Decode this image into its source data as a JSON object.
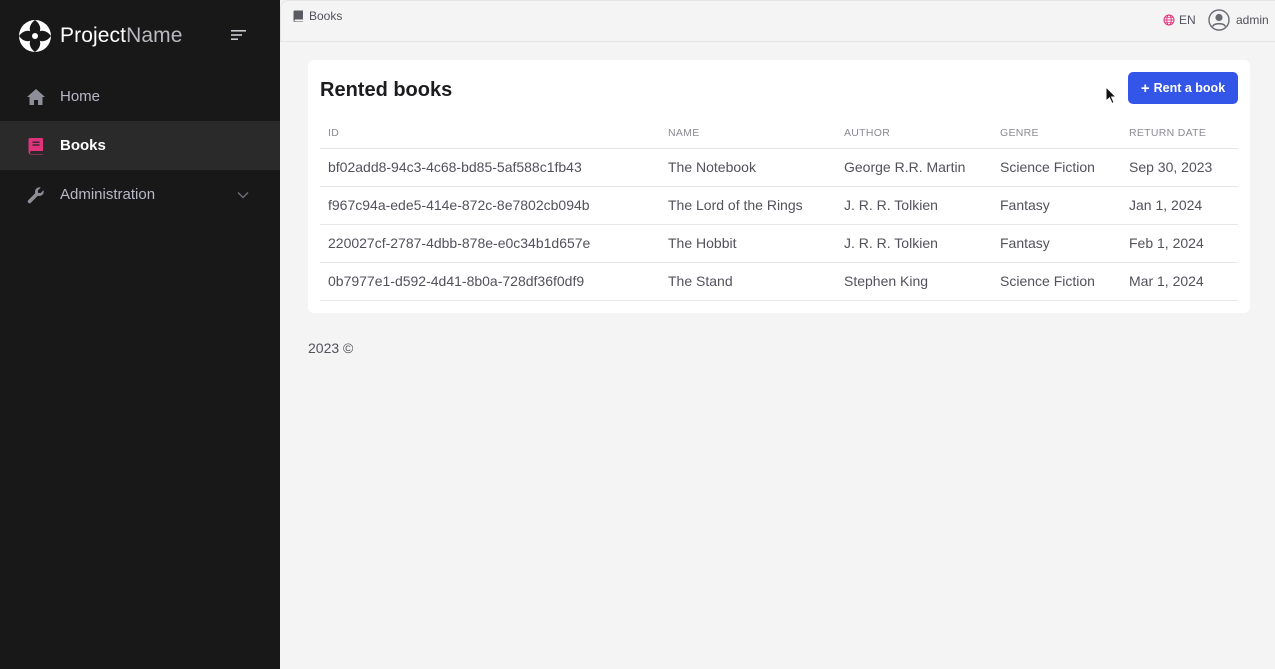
{
  "brand": {
    "name_bold": "Project",
    "name_light": "Name"
  },
  "sidebar": {
    "items": [
      {
        "label": "Home",
        "icon": "home-icon",
        "active": false
      },
      {
        "label": "Books",
        "icon": "book-icon",
        "active": true
      },
      {
        "label": "Administration",
        "icon": "wrench-icon",
        "active": false,
        "expandable": true
      }
    ]
  },
  "topbar": {
    "breadcrumb": "Books",
    "language": "EN",
    "user": "admin"
  },
  "card": {
    "title": "Rented books",
    "rent_button_label": "Rent a book",
    "columns": [
      "ID",
      "NAME",
      "AUTHOR",
      "GENRE",
      "RETURN DATE"
    ],
    "rows": [
      [
        "bf02add8-94c3-4c68-bd85-5af588c1fb43",
        "The Notebook",
        "George R.R. Martin",
        "Science Fiction",
        "Sep 30, 2023"
      ],
      [
        "f967c94a-ede5-414e-872c-8e7802cb094b",
        "The Lord of the Rings",
        "J. R. R. Tolkien",
        "Fantasy",
        "Jan 1, 2024"
      ],
      [
        "220027cf-2787-4dbb-878e-e0c34b1d657e",
        "The Hobbit",
        "J. R. R. Tolkien",
        "Fantasy",
        "Feb 1, 2024"
      ],
      [
        "0b7977e1-d592-4d41-8b0a-728df36f0df9",
        "The Stand",
        "Stephen King",
        "Science Fiction",
        "Mar 1, 2024"
      ]
    ]
  },
  "footer": {
    "text": "2023 ©"
  },
  "colors": {
    "sidebar_bg": "#181818",
    "active_item_bg": "#2a2a2a",
    "accent_pink": "#e0337c",
    "primary_button": "#3355e8",
    "page_bg": "#f4f4f5"
  }
}
